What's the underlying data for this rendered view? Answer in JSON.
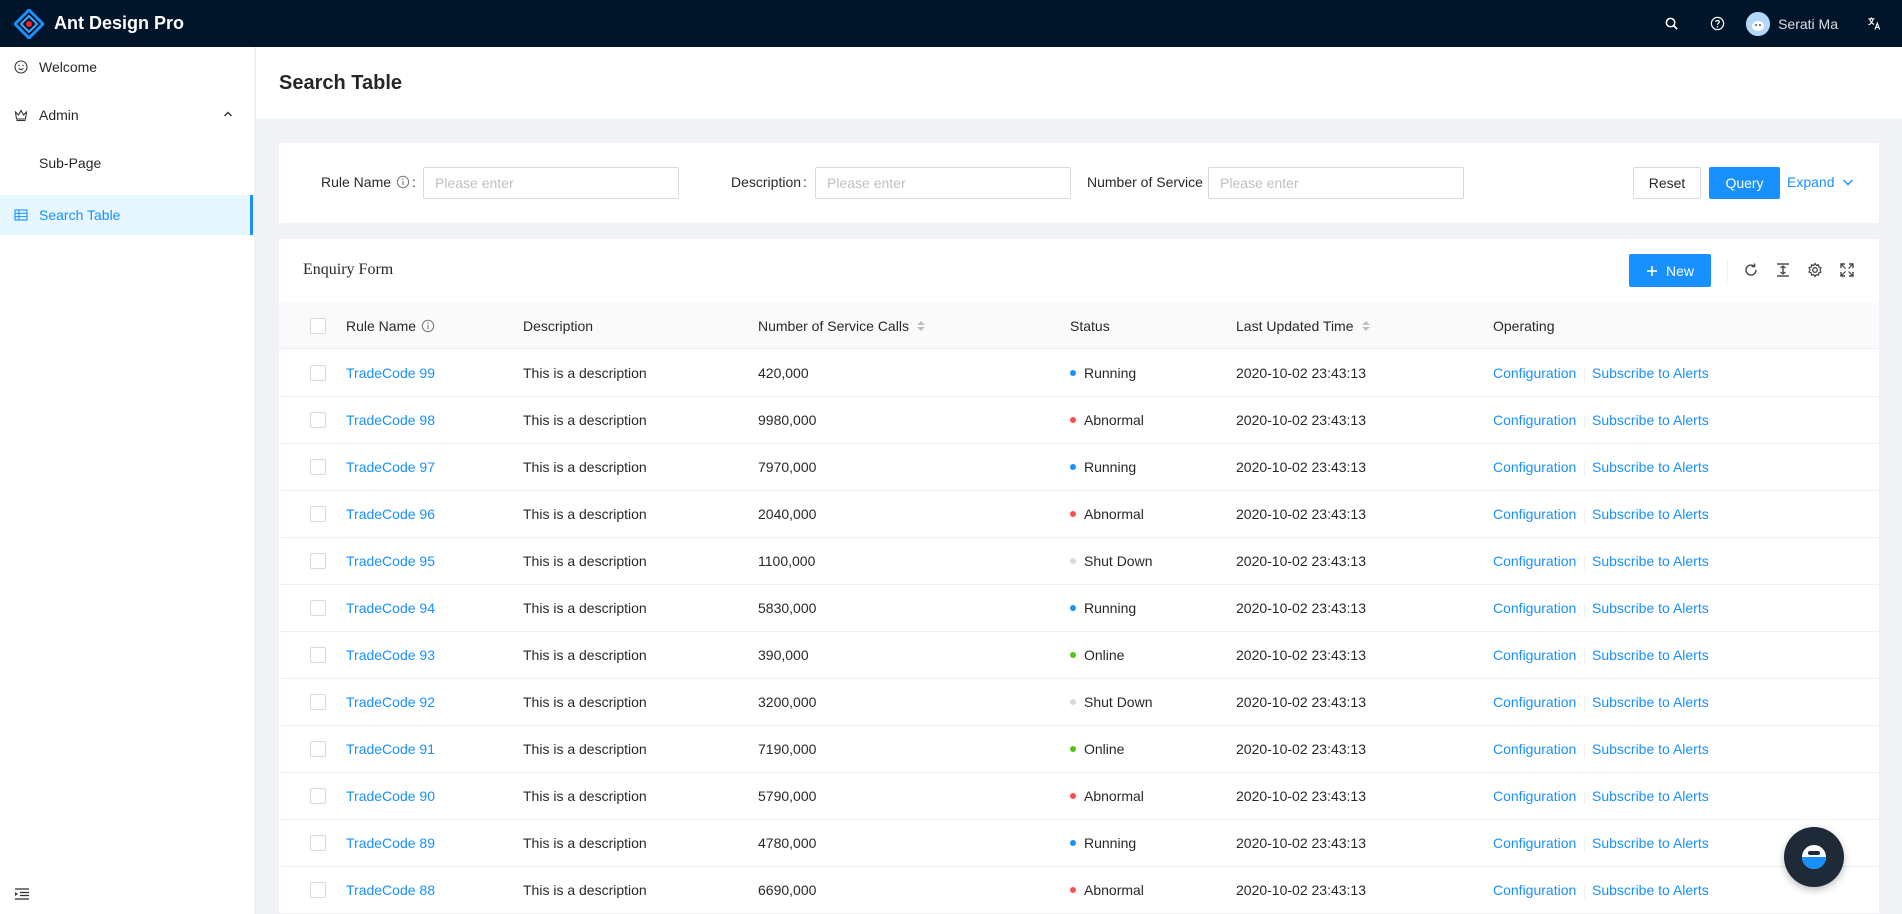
{
  "app": {
    "title": "Ant Design Pro",
    "user_name": "Serati Ma"
  },
  "sidebar": {
    "items": [
      {
        "label": "Welcome"
      },
      {
        "label": "Admin"
      },
      {
        "label": "Sub-Page"
      },
      {
        "label": "Search Table"
      }
    ]
  },
  "page": {
    "title": "Search Table"
  },
  "search": {
    "rule_name_label": "Rule Name",
    "description_label": "Description",
    "service_label": "Number of Service",
    "placeholder": "Please enter",
    "reset_label": "Reset",
    "query_label": "Query",
    "expand_label": "Expand"
  },
  "table": {
    "title": "Enquiry Form",
    "new_label": "New",
    "columns": [
      "Rule Name",
      "Description",
      "Number of Service Calls",
      "Status",
      "Last Updated Time",
      "Operating"
    ],
    "action_config": "Configuration",
    "action_subscribe": "Subscribe to Alerts",
    "rows": [
      {
        "name": "TradeCode 99",
        "desc": "This is a description",
        "calls": "420,000",
        "status": "Running",
        "updated": "2020-10-02 23:43:13"
      },
      {
        "name": "TradeCode 98",
        "desc": "This is a description",
        "calls": "9980,000",
        "status": "Abnormal",
        "updated": "2020-10-02 23:43:13"
      },
      {
        "name": "TradeCode 97",
        "desc": "This is a description",
        "calls": "7970,000",
        "status": "Running",
        "updated": "2020-10-02 23:43:13"
      },
      {
        "name": "TradeCode 96",
        "desc": "This is a description",
        "calls": "2040,000",
        "status": "Abnormal",
        "updated": "2020-10-02 23:43:13"
      },
      {
        "name": "TradeCode 95",
        "desc": "This is a description",
        "calls": "1100,000",
        "status": "Shut Down",
        "updated": "2020-10-02 23:43:13"
      },
      {
        "name": "TradeCode 94",
        "desc": "This is a description",
        "calls": "5830,000",
        "status": "Running",
        "updated": "2020-10-02 23:43:13"
      },
      {
        "name": "TradeCode 93",
        "desc": "This is a description",
        "calls": "390,000",
        "status": "Online",
        "updated": "2020-10-02 23:43:13"
      },
      {
        "name": "TradeCode 92",
        "desc": "This is a description",
        "calls": "3200,000",
        "status": "Shut Down",
        "updated": "2020-10-02 23:43:13"
      },
      {
        "name": "TradeCode 91",
        "desc": "This is a description",
        "calls": "7190,000",
        "status": "Online",
        "updated": "2020-10-02 23:43:13"
      },
      {
        "name": "TradeCode 90",
        "desc": "This is a description",
        "calls": "5790,000",
        "status": "Abnormal",
        "updated": "2020-10-02 23:43:13"
      },
      {
        "name": "TradeCode 89",
        "desc": "This is a description",
        "calls": "4780,000",
        "status": "Running",
        "updated": "2020-10-02 23:43:13"
      },
      {
        "name": "TradeCode 88",
        "desc": "This is a description",
        "calls": "6690,000",
        "status": "Abnormal",
        "updated": "2020-10-02 23:43:13"
      }
    ]
  },
  "colors": {
    "header_bg": "#001529",
    "primary": "#1890ff",
    "Running": "#1890ff",
    "Abnormal": "#ff4d4f",
    "Shut Down": "#d9d9d9",
    "Online": "#52c41a"
  },
  "icons": [
    "logo-icon",
    "search-icon",
    "question-icon",
    "translate-icon",
    "smile-icon",
    "crown-icon",
    "table-icon",
    "menu-fold-icon",
    "info-icon",
    "plus-icon",
    "reload-icon",
    "column-height-icon",
    "setting-icon",
    "fullscreen-icon",
    "chevron-up-icon",
    "chevron-down-icon"
  ]
}
